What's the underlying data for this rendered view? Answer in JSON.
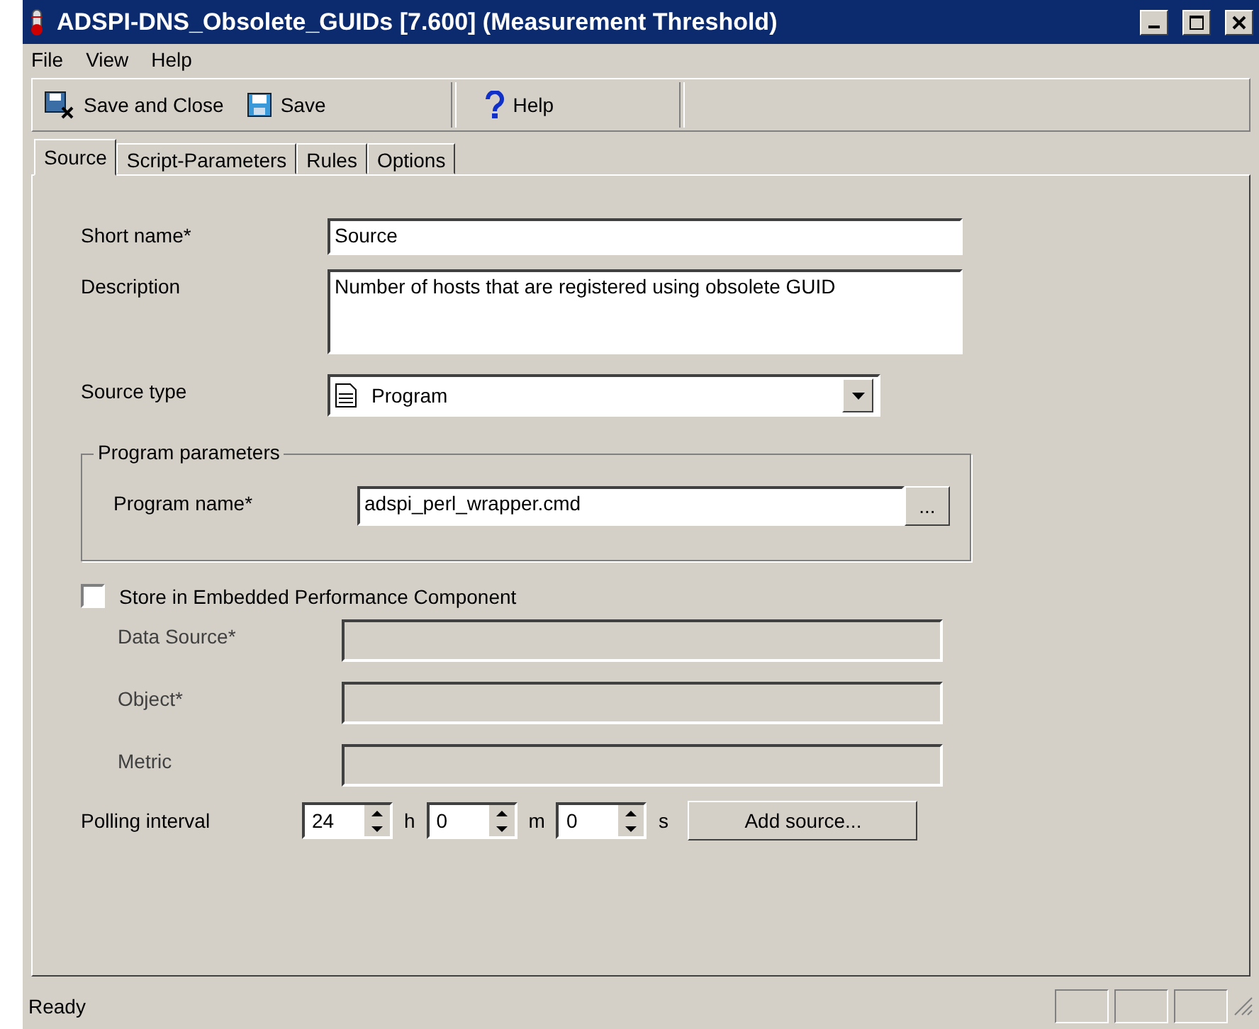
{
  "window": {
    "title": "ADSPI-DNS_Obsolete_GUIDs [7.600]  (Measurement Threshold)"
  },
  "menu": [
    "File",
    "View",
    "Help"
  ],
  "toolbar": [
    {
      "label": "Save and Close",
      "kind": "save-close"
    },
    {
      "label": "Save",
      "kind": "save"
    },
    {
      "label": "Help",
      "kind": "help"
    }
  ],
  "tabs": [
    {
      "label": "Source",
      "selected": true
    },
    {
      "label": "Script-Parameters",
      "selected": false
    },
    {
      "label": "Rules",
      "selected": false
    },
    {
      "label": "Options",
      "selected": false
    }
  ],
  "form": {
    "short_name": {
      "label": "Short name*",
      "value": "Source"
    },
    "description": {
      "label": "Description",
      "value": "Number of hosts that are registered using obsolete GUID"
    },
    "source_type": {
      "label": "Source type",
      "value": "Program"
    },
    "program_parameters": {
      "title": "Program parameters",
      "label": "Program name*",
      "value": "adspi_perl_wrapper.cmd",
      "browse": "..."
    },
    "store": {
      "label": "Store in Embedded Performance Component",
      "checked": false
    },
    "embedded_fields": [
      {
        "label": "Data Source*",
        "disabled": true
      },
      {
        "label": "Object*",
        "disabled": true
      },
      {
        "label": "Metric",
        "disabled": true
      }
    ],
    "polling": {
      "label": "Polling interval",
      "parts": [
        {
          "value": "24",
          "unit": "h"
        },
        {
          "value": "0",
          "unit": "m"
        },
        {
          "value": "0",
          "unit": "s"
        }
      ]
    },
    "add_button": "Add source..."
  },
  "status_bar": {
    "text": "Ready"
  }
}
